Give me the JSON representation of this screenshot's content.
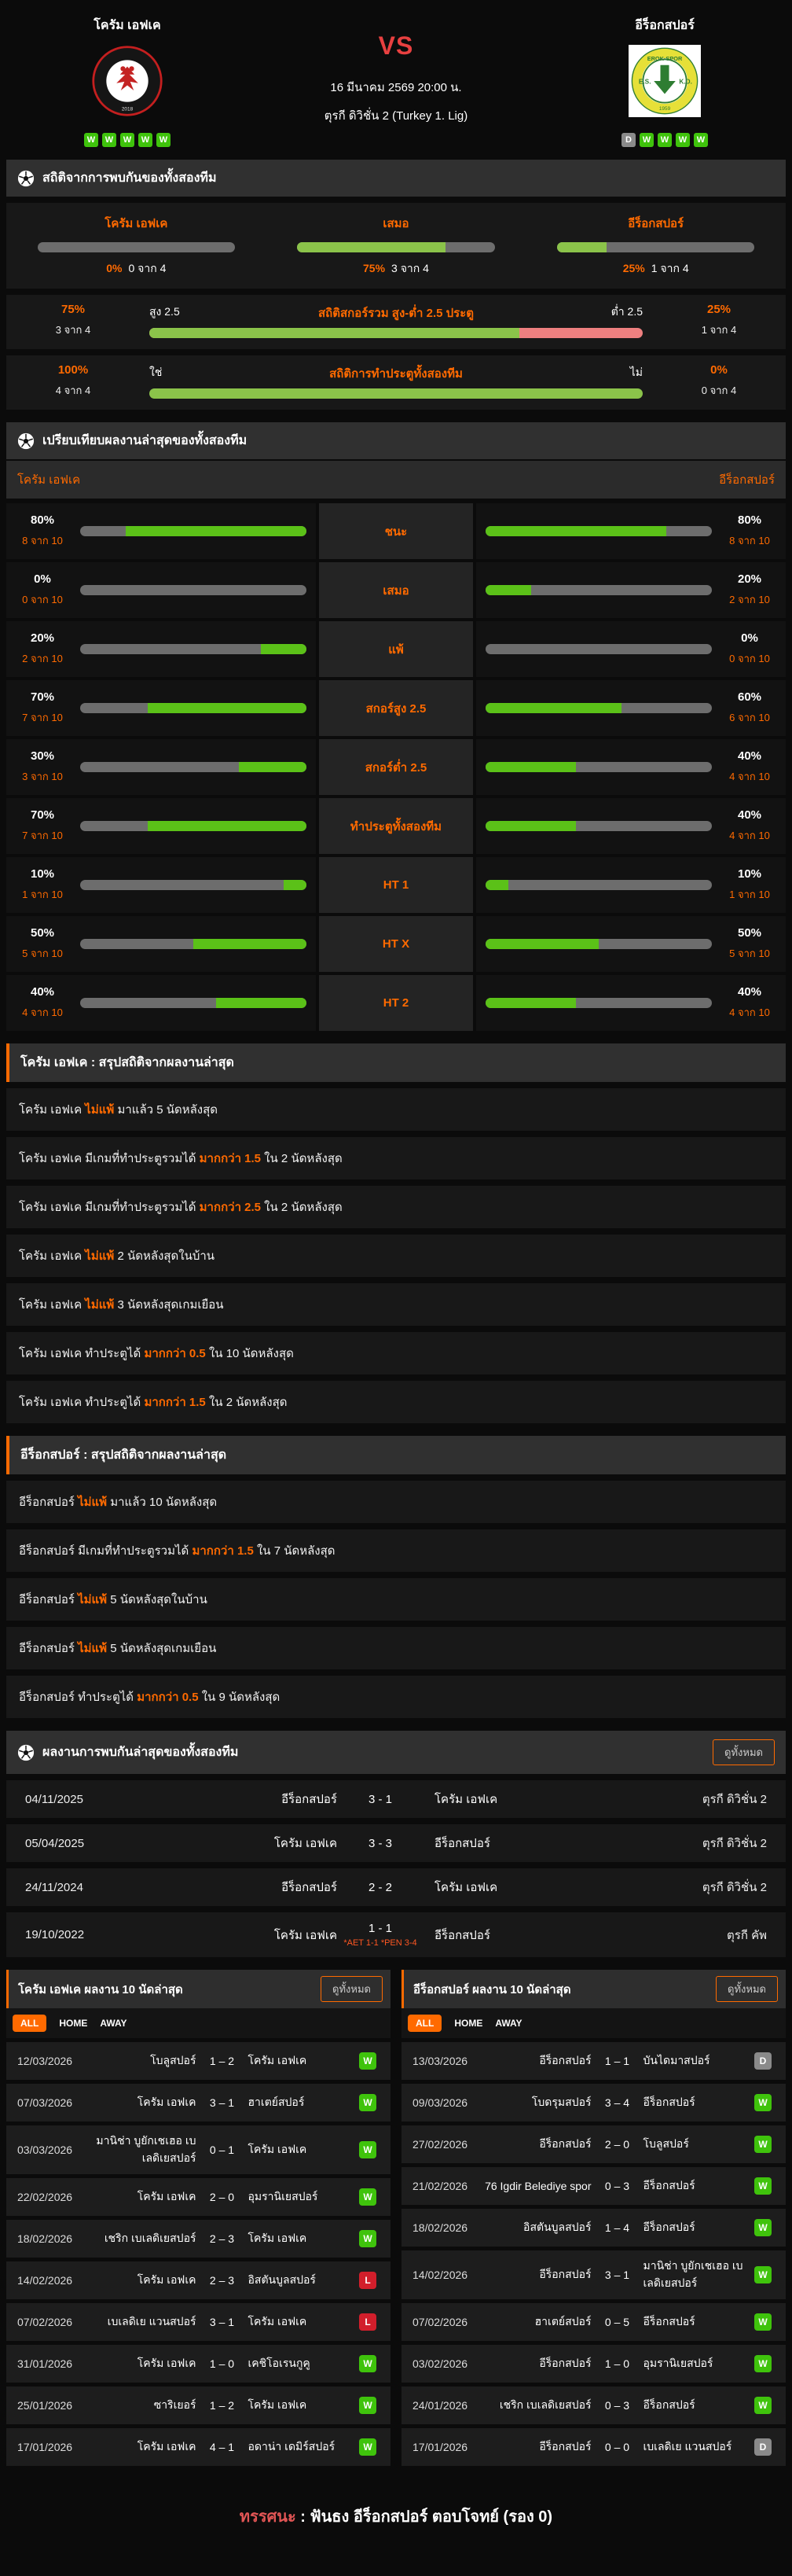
{
  "header": {
    "home_team": "โครัม เอฟเค",
    "away_team": "อีร็อกสปอร์",
    "vs": "VS",
    "datetime": "16 มีนาคม 2569 20:00 น.",
    "league": "ตุรกี ดิวิชั่น 2 (Turkey 1. Lig)",
    "home_logo_year": "2018",
    "away_logo_year": "1959",
    "home_form": [
      "W",
      "W",
      "W",
      "W",
      "W"
    ],
    "away_form": [
      "D",
      "W",
      "W",
      "W",
      "W"
    ]
  },
  "h2h_stats": {
    "title": "สถิติจากการพบกันของทั้งสองทีม",
    "cols": [
      {
        "label": "โครัม เอฟเค",
        "pct": "0%",
        "frac": "0 จาก 4",
        "value": 0
      },
      {
        "label": "เสมอ",
        "pct": "75%",
        "frac": "3 จาก 4",
        "value": 75
      },
      {
        "label": "อีร็อกสปอร์",
        "pct": "25%",
        "frac": "1 จาก 4",
        "value": 25
      }
    ],
    "ou_row": {
      "left_pct": "75%",
      "left_frac": "3 จาก 4",
      "left_label": "สูง 2.5",
      "title": "สถิติสกอร์รวม สูง-ต่ำ 2.5 ประตู",
      "right_label": "ต่ำ 2.5",
      "right_pct": "25%",
      "right_frac": "1 จาก 4",
      "green": 75
    },
    "btts_row": {
      "left_pct": "100%",
      "left_frac": "4 จาก 4",
      "left_label": "ใช่",
      "title": "สถิติการทำประตูทั้งสองทีม",
      "right_label": "ไม่",
      "right_pct": "0%",
      "right_frac": "0 จาก 4",
      "green": 100
    }
  },
  "compare": {
    "title": "เปรียบเทียบผลงานล่าสุดของทั้งสองทีม",
    "home": "โครัม เอฟเค",
    "away": "อีร็อกสปอร์",
    "rows": [
      {
        "label": "ชนะ",
        "l_pct": "80%",
        "l_frac": "8 จาก 10",
        "l": 80,
        "r_pct": "80%",
        "r_frac": "8 จาก 10",
        "r": 80
      },
      {
        "label": "เสมอ",
        "l_pct": "0%",
        "l_frac": "0 จาก 10",
        "l": 0,
        "r_pct": "20%",
        "r_frac": "2 จาก 10",
        "r": 20
      },
      {
        "label": "แพ้",
        "l_pct": "20%",
        "l_frac": "2 จาก 10",
        "l": 20,
        "r_pct": "0%",
        "r_frac": "0 จาก 10",
        "r": 0
      },
      {
        "label": "สกอร์สูง 2.5",
        "l_pct": "70%",
        "l_frac": "7 จาก 10",
        "l": 70,
        "r_pct": "60%",
        "r_frac": "6 จาก 10",
        "r": 60
      },
      {
        "label": "สกอร์ต่ำ 2.5",
        "l_pct": "30%",
        "l_frac": "3 จาก 10",
        "l": 30,
        "r_pct": "40%",
        "r_frac": "4 จาก 10",
        "r": 40
      },
      {
        "label": "ทำประตูทั้งสองทีม",
        "l_pct": "70%",
        "l_frac": "7 จาก 10",
        "l": 70,
        "r_pct": "40%",
        "r_frac": "4 จาก 10",
        "r": 40
      },
      {
        "label": "HT 1",
        "l_pct": "10%",
        "l_frac": "1 จาก 10",
        "l": 10,
        "r_pct": "10%",
        "r_frac": "1 จาก 10",
        "r": 10
      },
      {
        "label": "HT X",
        "l_pct": "50%",
        "l_frac": "5 จาก 10",
        "l": 50,
        "r_pct": "50%",
        "r_frac": "5 จาก 10",
        "r": 50
      },
      {
        "label": "HT 2",
        "l_pct": "40%",
        "l_frac": "4 จาก 10",
        "l": 40,
        "r_pct": "40%",
        "r_frac": "4 จาก 10",
        "r": 40
      }
    ]
  },
  "team1_summary": {
    "title": "โครัม เอฟเค : สรุปสถิติจากผลงานล่าสุด",
    "rows": [
      {
        "pre": "โครัม เอฟเค ",
        "hl": "ไม่แพ้",
        "post": " มาแล้ว 5 นัดหลังสุด"
      },
      {
        "pre": "โครัม เอฟเค  มีเกมที่ทำประตูรวมได้ ",
        "hl": "มากกว่า 1.5",
        "post": " ใน 2 นัดหลังสุด"
      },
      {
        "pre": "โครัม เอฟเค  มีเกมที่ทำประตูรวมได้ ",
        "hl": "มากกว่า 2.5",
        "post": " ใน 2 นัดหลังสุด"
      },
      {
        "pre": "โครัม เอฟเค ",
        "hl": "ไม่แพ้",
        "post": " 2  นัดหลังสุดในบ้าน"
      },
      {
        "pre": "โครัม เอฟเค ",
        "hl": "ไม่แพ้",
        "post": " 3  นัดหลังสุดเกมเยือน"
      },
      {
        "pre": "โครัม เอฟเค  ทำประตูได้ ",
        "hl": "มากกว่า 0.5",
        "post": " ใน 10 นัดหลังสุด"
      },
      {
        "pre": "โครัม เอฟเค  ทำประตูได้ ",
        "hl": "มากกว่า 1.5",
        "post": " ใน 2 นัดหลังสุด"
      }
    ]
  },
  "team2_summary": {
    "title": "อีร็อกสปอร์ : สรุปสถิติจากผลงานล่าสุด",
    "rows": [
      {
        "pre": "อีร็อกสปอร์ ",
        "hl": "ไม่แพ้",
        "post": " มาแล้ว 10 นัดหลังสุด"
      },
      {
        "pre": "อีร็อกสปอร์  มีเกมที่ทำประตูรวมได้ ",
        "hl": "มากกว่า 1.5",
        "post": " ใน 7 นัดหลังสุด"
      },
      {
        "pre": "อีร็อกสปอร์ ",
        "hl": "ไม่แพ้",
        "post": " 5  นัดหลังสุดในบ้าน"
      },
      {
        "pre": "อีร็อกสปอร์ ",
        "hl": "ไม่แพ้",
        "post": " 5  นัดหลังสุดเกมเยือน"
      },
      {
        "pre": "อีร็อกสปอร์  ทำประตูได้ ",
        "hl": "มากกว่า 0.5",
        "post": " ใน 9 นัดหลังสุด"
      }
    ]
  },
  "h2h_results": {
    "title": "ผลงานการพบกันล่าสุดของทั้งสองทีม",
    "view_all": "ดูทั้งหมด",
    "rows": [
      {
        "date": "04/11/2025",
        "home": "อีร็อกสปอร์",
        "score": "3 - 1",
        "away": "โครัม เอฟเค",
        "league": "ตุรกี ดิวิชั่น 2",
        "note": ""
      },
      {
        "date": "05/04/2025",
        "home": "โครัม เอฟเค",
        "score": "3 - 3",
        "away": "อีร็อกสปอร์",
        "league": "ตุรกี ดิวิชั่น 2",
        "note": ""
      },
      {
        "date": "24/11/2024",
        "home": "อีร็อกสปอร์",
        "score": "2 - 2",
        "away": "โครัม เอฟเค",
        "league": "ตุรกี ดิวิชั่น 2",
        "note": ""
      },
      {
        "date": "19/10/2022",
        "home": "โครัม เอฟเค",
        "score": "1 - 1",
        "away": "อีร็อกสปอร์",
        "league": "ตุรกี คัพ",
        "note": "*AET 1-1 *PEN 3-4"
      }
    ]
  },
  "team1_matches": {
    "title": "โครัม เอฟเค ผลงาน 10 นัดล่าสุด",
    "view_all": "ดูทั้งหมด",
    "tabs": {
      "all": "ALL",
      "home": "HOME",
      "away": "AWAY"
    },
    "rows": [
      {
        "date": "12/03/2026",
        "home": "โบลูสปอร์",
        "score": "1 – 2",
        "away": "โครัม เอฟเค",
        "result": "W"
      },
      {
        "date": "07/03/2026",
        "home": "โครัม เอฟเค",
        "score": "3 – 1",
        "away": "ฮาเตย์สปอร์",
        "result": "W"
      },
      {
        "date": "03/03/2026",
        "home": "มานิช่า บูยักเชเฮอ เบเลดิเยสปอร์",
        "score": "0 – 1",
        "away": "โครัม เอฟเค",
        "result": "W"
      },
      {
        "date": "22/02/2026",
        "home": "โครัม เอฟเค",
        "score": "2 – 0",
        "away": "อุมรานิเยสปอร์",
        "result": "W"
      },
      {
        "date": "18/02/2026",
        "home": "เชริก เบเลดิเยสปอร์",
        "score": "2 – 3",
        "away": "โครัม เอฟเค",
        "result": "W"
      },
      {
        "date": "14/02/2026",
        "home": "โครัม เอฟเค",
        "score": "2 – 3",
        "away": "อิสตันบูลสปอร์",
        "result": "L"
      },
      {
        "date": "07/02/2026",
        "home": "เบเลดิเย แวนสปอร์",
        "score": "3 – 1",
        "away": "โครัม เอฟเค",
        "result": "L"
      },
      {
        "date": "31/01/2026",
        "home": "โครัม เอฟเค",
        "score": "1 – 0",
        "away": "เคชิโอเรนกูคู",
        "result": "W"
      },
      {
        "date": "25/01/2026",
        "home": "ซาริเยอร์",
        "score": "1 – 2",
        "away": "โครัม เอฟเค",
        "result": "W"
      },
      {
        "date": "17/01/2026",
        "home": "โครัม เอฟเค",
        "score": "4 – 1",
        "away": "อดาน่า เดมิร์สปอร์",
        "result": "W"
      }
    ]
  },
  "team2_matches": {
    "title": "อีร็อกสปอร์ ผลงาน 10 นัดล่าสุด",
    "view_all": "ดูทั้งหมด",
    "tabs": {
      "all": "ALL",
      "home": "HOME",
      "away": "AWAY"
    },
    "rows": [
      {
        "date": "13/03/2026",
        "home": "อีร็อกสปอร์",
        "score": "1 – 1",
        "away": "บันไดมาสปอร์",
        "result": "D"
      },
      {
        "date": "09/03/2026",
        "home": "โบดรุมสปอร์",
        "score": "3 – 4",
        "away": "อีร็อกสปอร์",
        "result": "W"
      },
      {
        "date": "27/02/2026",
        "home": "อีร็อกสปอร์",
        "score": "2 – 0",
        "away": "โบลูสปอร์",
        "result": "W"
      },
      {
        "date": "21/02/2026",
        "home": "76 Igdir Belediye spor",
        "score": "0 – 3",
        "away": "อีร็อกสปอร์",
        "result": "W"
      },
      {
        "date": "18/02/2026",
        "home": "อิสตันบูลสปอร์",
        "score": "1 – 4",
        "away": "อีร็อกสปอร์",
        "result": "W"
      },
      {
        "date": "14/02/2026",
        "home": "อีร็อกสปอร์",
        "score": "3 – 1",
        "away": "มานิช่า บูยักเชเฮอ เบเลดิเยสปอร์",
        "result": "W"
      },
      {
        "date": "07/02/2026",
        "home": "ฮาเตย์สปอร์",
        "score": "0 – 5",
        "away": "อีร็อกสปอร์",
        "result": "W"
      },
      {
        "date": "03/02/2026",
        "home": "อีร็อกสปอร์",
        "score": "1 – 0",
        "away": "อุมรานิเยสปอร์",
        "result": "W"
      },
      {
        "date": "24/01/2026",
        "home": "เชริก เบเลดิเยสปอร์",
        "score": "0 – 3",
        "away": "อีร็อกสปอร์",
        "result": "W"
      },
      {
        "date": "17/01/2026",
        "home": "อีร็อกสปอร์",
        "score": "0 – 0",
        "away": "เบเลดิเย แวนสปอร์",
        "result": "D"
      }
    ]
  },
  "footer": {
    "label": "ทรรศนะ",
    "text": " :  ฟันธง อีร็อกสปอร์ ตอบโจทย์ (รอง 0)"
  },
  "colors": {
    "accent_orange": "#ff6a00",
    "green_bar": "#5bc118",
    "light_green_bar": "#8bc34a",
    "red_bar": "#ee8080",
    "win_badge": "#3fc30c",
    "lose_badge": "#d21e2b",
    "draw_badge": "#8a8a8a",
    "vs_red": "#e84040"
  }
}
